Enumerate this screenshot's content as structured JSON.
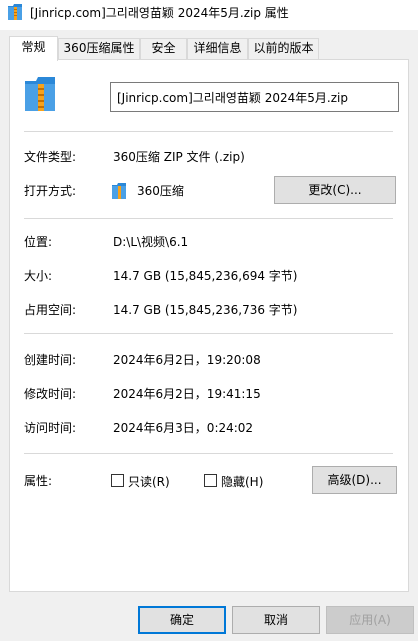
{
  "window": {
    "title": "[Jinricp.com]그리래영苗颖 2024年5月.zip 属性",
    "icon": "zip-archive-icon"
  },
  "tabs": [
    {
      "label": "常规",
      "active": true
    },
    {
      "label": "360压缩属性",
      "active": false
    },
    {
      "label": "安全",
      "active": false
    },
    {
      "label": "详细信息",
      "active": false
    },
    {
      "label": "以前的版本",
      "active": false
    }
  ],
  "general": {
    "file_name": "[Jinricp.com]그리래영苗颖 2024年5月.zip",
    "file_type_label": "文件类型:",
    "file_type_value": "360压缩 ZIP 文件 (.zip)",
    "open_with_label": "打开方式:",
    "open_with_value": "360压缩",
    "change_button": "更改(C)...",
    "location_label": "位置:",
    "location_value": "D:\\L\\视频\\6.1",
    "size_label": "大小:",
    "size_value": "14.7 GB (15,845,236,694 字节)",
    "size_on_disk_label": "占用空间:",
    "size_on_disk_value": "14.7 GB (15,845,236,736 字节)",
    "created_label": "创建时间:",
    "created_value": "2024年6月2日，19:20:08",
    "modified_label": "修改时间:",
    "modified_value": "2024年6月2日，19:41:15",
    "accessed_label": "访问时间:",
    "accessed_value": "2024年6月3日，0:24:02",
    "attributes_label": "属性:",
    "readonly_label": "只读(R)",
    "readonly_checked": false,
    "hidden_label": "隐藏(H)",
    "hidden_checked": false,
    "advanced_button": "高级(D)..."
  },
  "footer": {
    "ok": "确定",
    "cancel": "取消",
    "apply": "应用(A)"
  },
  "colors": {
    "accent": "#0078d7",
    "zip_blue": "#2b88d8",
    "zip_orange": "#f7a21b"
  }
}
